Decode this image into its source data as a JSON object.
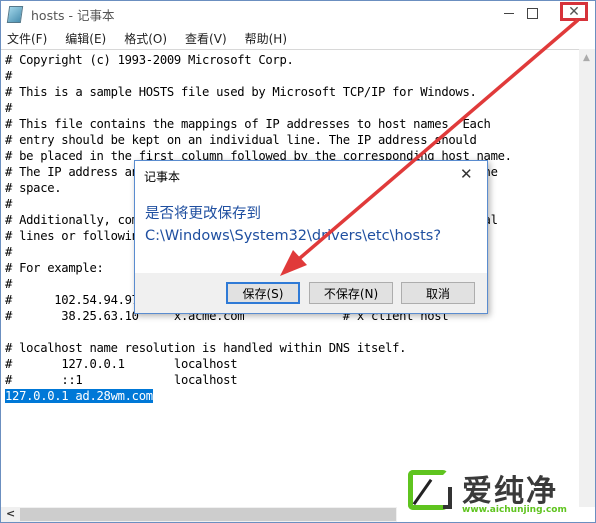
{
  "window": {
    "title": "hosts - 记事本",
    "icon": "notepad-icon",
    "controls": {
      "minimize": "minimize-icon",
      "maximize": "maximize-icon",
      "close": "close-icon",
      "close_glyph": "✕"
    }
  },
  "menu": {
    "items": [
      {
        "label": "文件(F)"
      },
      {
        "label": "编辑(E)"
      },
      {
        "label": "格式(O)"
      },
      {
        "label": "查看(V)"
      },
      {
        "label": "帮助(H)"
      }
    ]
  },
  "editor": {
    "lines": [
      "# Copyright (c) 1993-2009 Microsoft Corp.",
      "#",
      "# This is a sample HOSTS file used by Microsoft TCP/IP for Windows.",
      "#",
      "# This file contains the mappings of IP addresses to host names. Each",
      "# entry should be kept on an individual line. The IP address should",
      "# be placed in the first column followed by the corresponding host name.",
      "# The IP address and the host name should be separated by at least one",
      "# space.",
      "#",
      "# Additionally, comments (such as these) may be inserted on individual",
      "# lines or following the machine name denoted by a '#' symbol.",
      "#",
      "# For example:",
      "#",
      "#      102.54.94.97     rhino.acme.com          # source server",
      "#       38.25.63.10     x.acme.com              # x client host",
      "",
      "# localhost name resolution is handled within DNS itself.",
      "#\t127.0.0.1       localhost",
      "#\t::1             localhost"
    ],
    "selected_line": "127.0.0.1 ad.28wm.com"
  },
  "scrollbars": {
    "up_arrow": "▲",
    "left_arrow": "<"
  },
  "dialog": {
    "title": "记事本",
    "close_glyph": "✕",
    "message_line1": "是否将更改保存到",
    "message_line2": "C:\\Windows\\System32\\drivers\\etc\\hosts?",
    "buttons": {
      "save": "保存(S)",
      "dont_save": "不保存(N)",
      "cancel": "取消"
    }
  },
  "annotation": {
    "arrow_color": "#e03a3a",
    "highlight_color": "#d6323a"
  },
  "watermark": {
    "brand": "爱纯净",
    "url": "www.aichunjing.com",
    "accent": "#5fc41f"
  }
}
